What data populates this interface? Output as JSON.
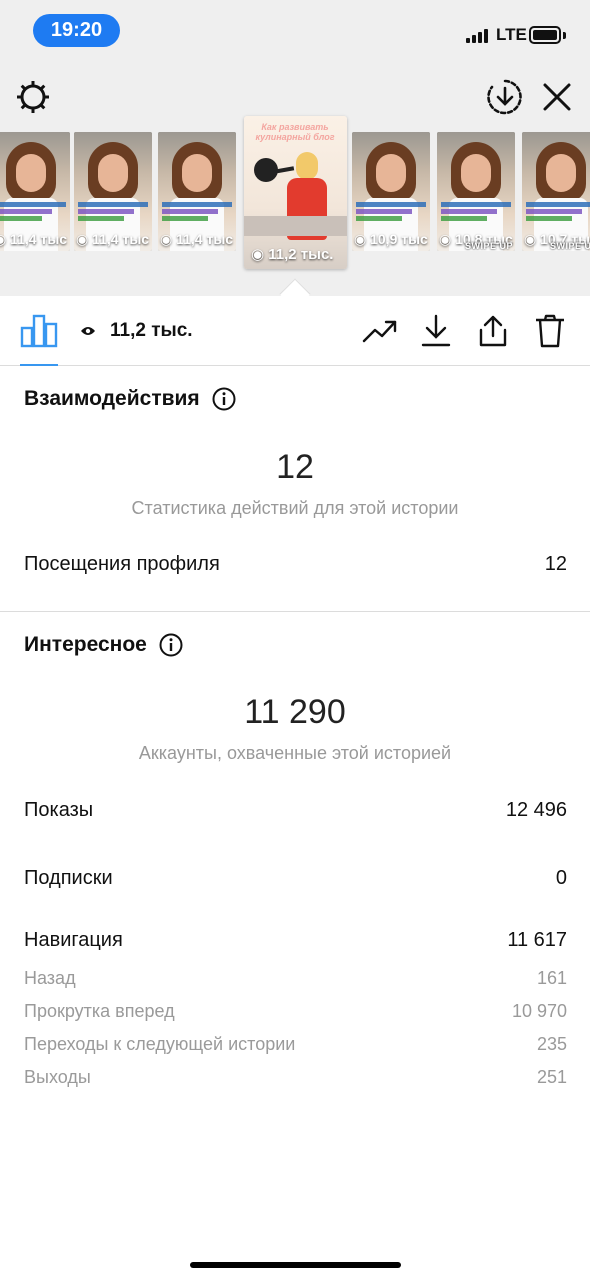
{
  "status_bar": {
    "time": "19:20",
    "network": "LTE"
  },
  "header": {
    "settings_icon": "gear-icon",
    "save_icon": "download-circle-icon",
    "close_icon": "close-icon"
  },
  "thumbnails": [
    {
      "views": "11,4 тыс"
    },
    {
      "views": "11,4 тыс"
    },
    {
      "views": "11,4 тыс"
    },
    {
      "views": "11,2 тыс.",
      "selected": true,
      "title": "Как развивать кулинарный блог"
    },
    {
      "views": "10,9 тыс"
    },
    {
      "views": "10,8 тыс",
      "sticker": "SWIPE UP"
    },
    {
      "views": "10,7 тыс",
      "sticker": "SWIPE UP"
    }
  ],
  "toolbar": {
    "insights_icon": "bar-chart-icon",
    "views_icon": "eye-icon",
    "views": "11,2 тыс.",
    "promote_icon": "trend-up-icon",
    "download_icon": "download-icon",
    "share_icon": "share-icon",
    "delete_icon": "trash-icon"
  },
  "interactions": {
    "title": "Взаимодействия",
    "total": "12",
    "caption": "Статистика действий для этой истории",
    "rows": [
      {
        "label": "Посещения профиля",
        "value": "12"
      }
    ]
  },
  "discovery": {
    "title": "Интересное",
    "total": "11 290",
    "caption": "Аккаунты, охваченные этой историей",
    "rows": [
      {
        "label": "Показы",
        "value": "12 496"
      },
      {
        "label": "Подписки",
        "value": "0"
      },
      {
        "label": "Навигация",
        "value": "11 617"
      }
    ],
    "navigation": [
      {
        "label": "Назад",
        "value": "161"
      },
      {
        "label": "Прокрутка вперед",
        "value": "10 970"
      },
      {
        "label": "Переходы к следующей истории",
        "value": "235"
      },
      {
        "label": "Выходы",
        "value": "251"
      }
    ]
  },
  "colors": {
    "accent": "#3897f0",
    "time_pill": "#1e7bf2",
    "muted": "#999999"
  }
}
